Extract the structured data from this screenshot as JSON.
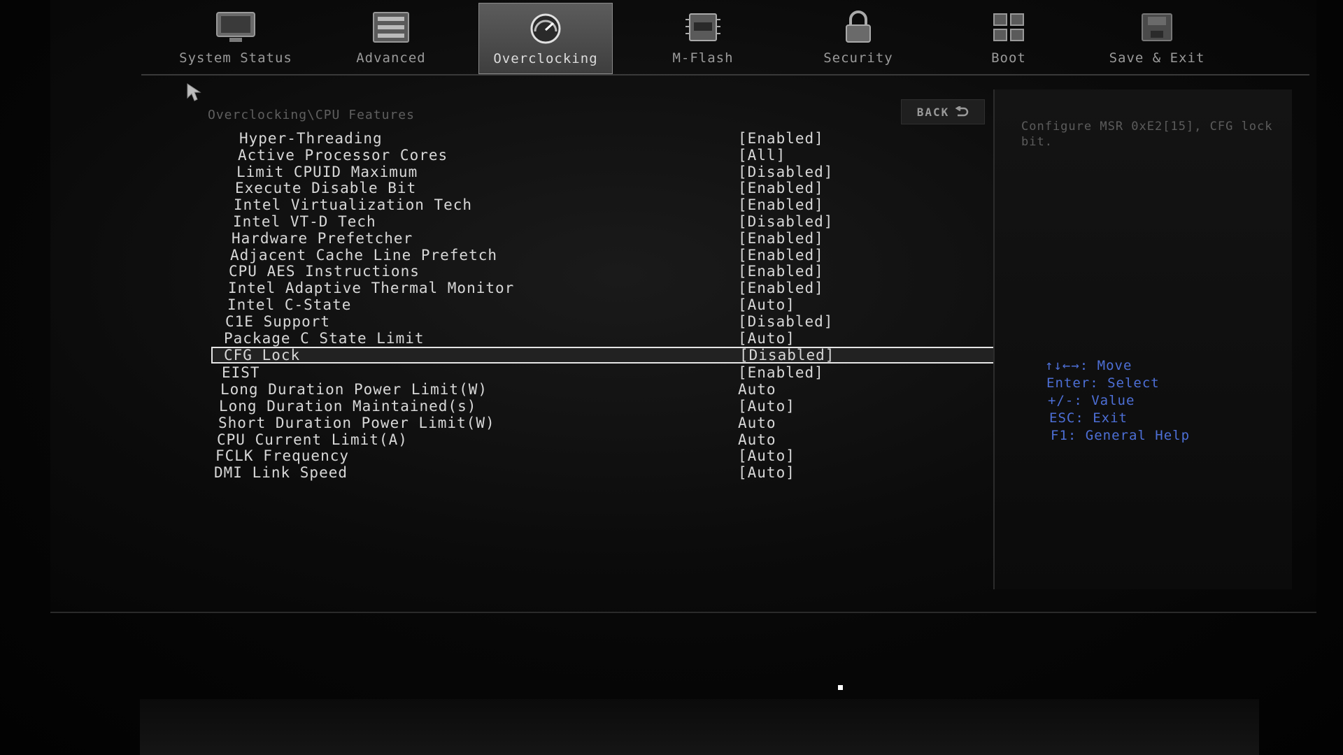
{
  "nav": {
    "tabs": [
      {
        "label": "System Status",
        "icon": "monitor-icon"
      },
      {
        "label": "Advanced",
        "icon": "sliders-icon"
      },
      {
        "label": "Overclocking",
        "icon": "gauge-icon"
      },
      {
        "label": "M-Flash",
        "icon": "flash-chip-icon"
      },
      {
        "label": "Security",
        "icon": "padlock-icon"
      },
      {
        "label": "Boot",
        "icon": "boot-grid-icon"
      },
      {
        "label": "Save & Exit",
        "icon": "save-exit-icon"
      }
    ],
    "active_tab": "Overclocking"
  },
  "main": {
    "breadcrumb": "Overclocking\\CPU Features",
    "back_label": "BACK",
    "settings": [
      {
        "name": "Hyper-Threading",
        "value": "[Enabled]"
      },
      {
        "name": "Active Processor Cores",
        "value": "[All]"
      },
      {
        "name": "Limit CPUID Maximum",
        "value": "[Disabled]"
      },
      {
        "name": "Execute Disable Bit",
        "value": "[Enabled]"
      },
      {
        "name": "Intel Virtualization Tech",
        "value": "[Enabled]"
      },
      {
        "name": "Intel VT-D Tech",
        "value": "[Disabled]"
      },
      {
        "name": "Hardware Prefetcher",
        "value": "[Enabled]"
      },
      {
        "name": "Adjacent Cache Line Prefetch",
        "value": "[Enabled]"
      },
      {
        "name": "CPU AES Instructions",
        "value": "[Enabled]"
      },
      {
        "name": "Intel Adaptive Thermal Monitor",
        "value": "[Enabled]"
      },
      {
        "name": "Intel C-State",
        "value": "[Auto]"
      },
      {
        "name": "C1E Support",
        "value": "[Disabled]"
      },
      {
        "name": "Package C State Limit",
        "value": "[Auto]"
      },
      {
        "name": "CFG Lock",
        "value": "[Disabled]"
      },
      {
        "name": "EIST",
        "value": "[Enabled]"
      },
      {
        "name": "Long Duration Power Limit(W)",
        "value": "Auto"
      },
      {
        "name": "Long Duration Maintained(s)",
        "value": "[Auto]"
      },
      {
        "name": "Short Duration Power Limit(W)",
        "value": "Auto"
      },
      {
        "name": "CPU Current Limit(A)",
        "value": "Auto"
      },
      {
        "name": "FCLK Frequency",
        "value": "[Auto]"
      },
      {
        "name": "DMI Link Speed",
        "value": "[Auto]"
      }
    ],
    "selected_index": 13
  },
  "help": {
    "text": "Configure MSR 0xE2[15], CFG lock bit.",
    "keys": [
      "↑↓←→: Move",
      "Enter: Select",
      "+/-: Value",
      "ESC: Exit",
      "F1: General Help"
    ]
  },
  "colors": {
    "key_help": "#4d6fd6",
    "text": "#d8d8d8",
    "selection_border": "#e5e5e5"
  }
}
